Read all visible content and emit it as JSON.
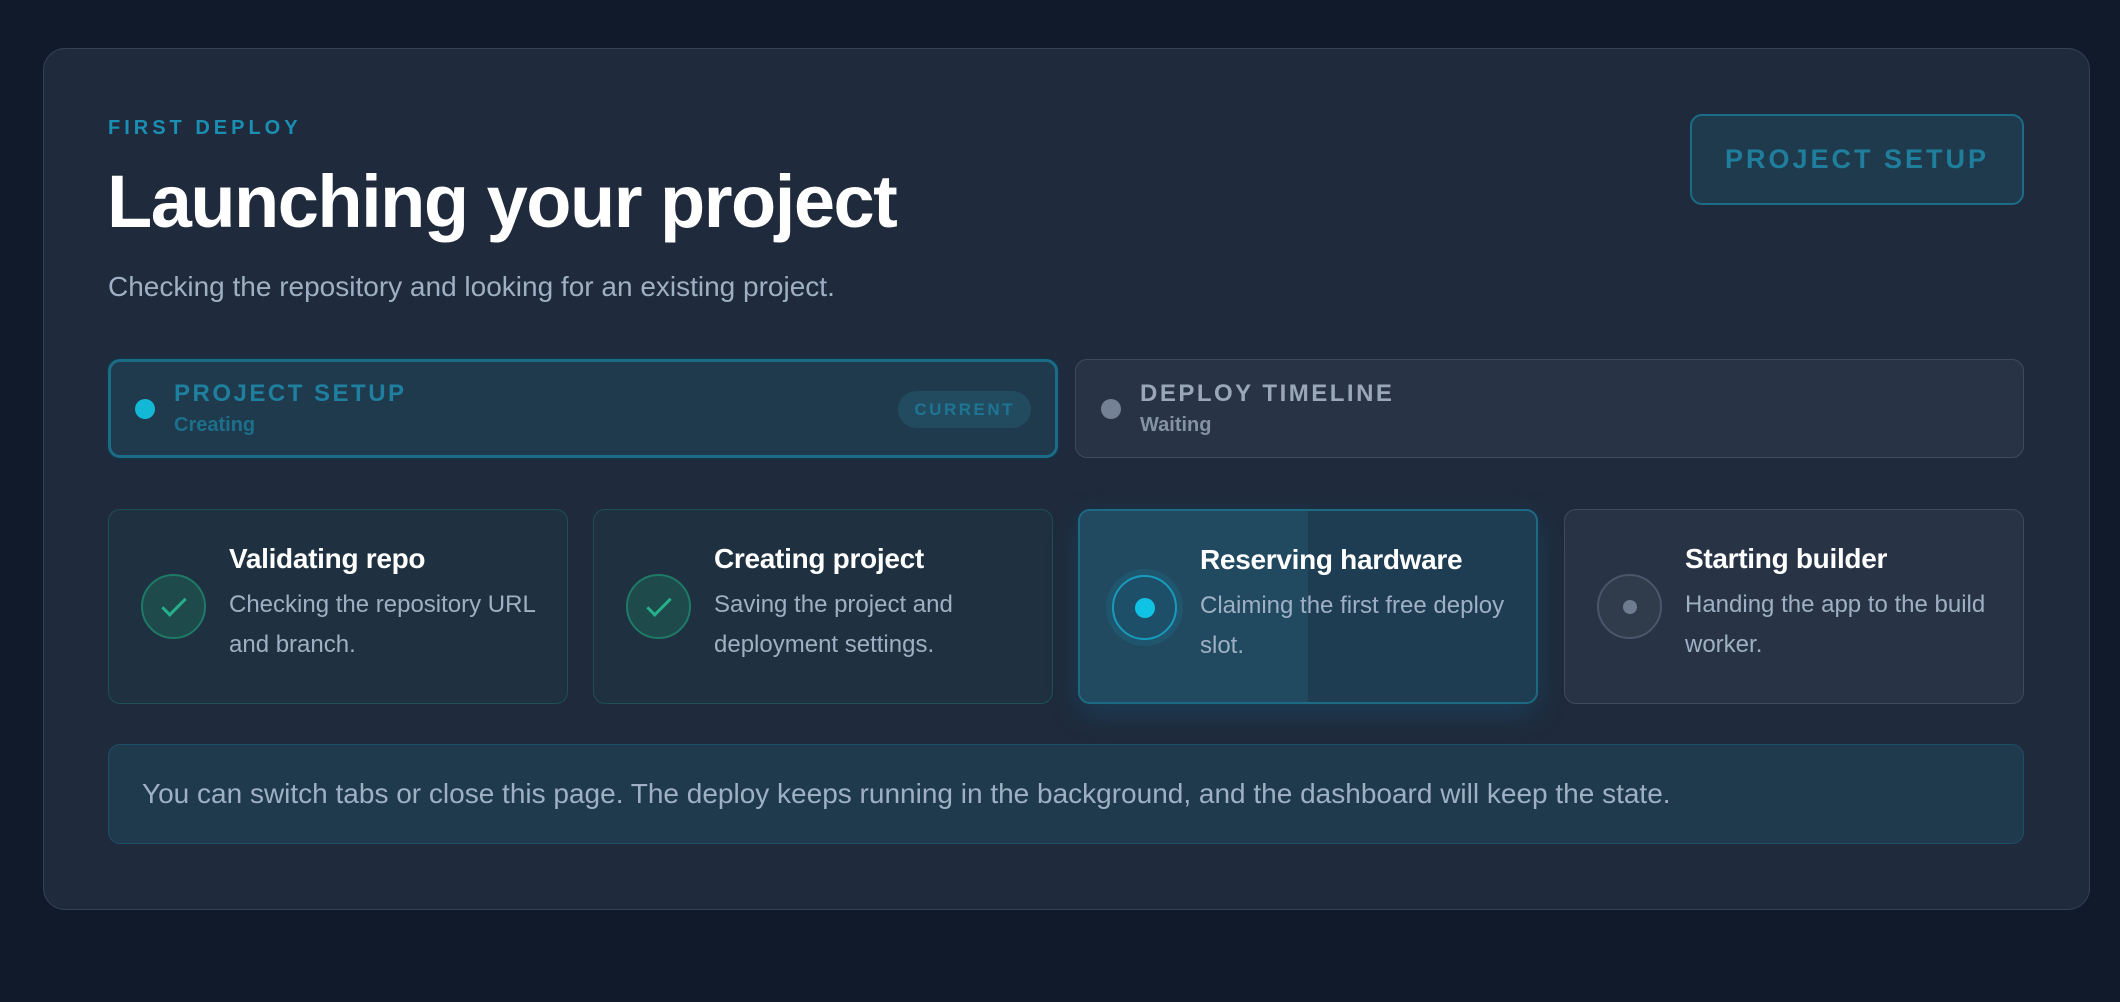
{
  "header": {
    "eyebrow": "FIRST DEPLOY",
    "title": "Launching your project",
    "subtitle": "Checking the repository and looking for an existing project.",
    "badge": "PROJECT SETUP"
  },
  "tabs": [
    {
      "label": "PROJECT SETUP",
      "status": "Creating",
      "pill": "CURRENT",
      "state": "current"
    },
    {
      "label": "DEPLOY TIMELINE",
      "status": "Waiting",
      "state": "waiting"
    }
  ],
  "steps": [
    {
      "title": "Validating repo",
      "description": "Checking the repository URL and branch.",
      "state": "done",
      "icon": "check-icon"
    },
    {
      "title": "Creating project",
      "description": "Saving the project and deployment settings.",
      "state": "done",
      "icon": "check-icon"
    },
    {
      "title": "Reserving hardware",
      "description": "Claiming the first free deploy slot.",
      "state": "active",
      "icon": "active-dot-icon"
    },
    {
      "title": "Starting builder",
      "description": "Handing the app to the build worker.",
      "state": "pending",
      "icon": "pending-dot-icon"
    }
  ],
  "notice": "You can switch tabs or close this page. The deploy keeps running in the background, and the dashboard will keep the state.",
  "colors": {
    "background": "#111a2b",
    "panel": "#1f2a3c",
    "accent": "#13b8d6",
    "success": "#25b08a",
    "muted": "#748195"
  }
}
